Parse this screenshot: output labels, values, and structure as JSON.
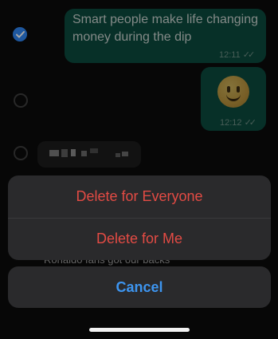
{
  "messages": [
    {
      "text": "Smart people make life changing money during the dip",
      "time": "12:11",
      "selected": true
    },
    {
      "emoji": "slightly-smiling-face-emoji",
      "time": "12:12",
      "selected": false
    },
    {
      "text": "",
      "selected": false
    }
  ],
  "preview_text": "Ronaldo fans got our backs",
  "action_sheet": {
    "delete_everyone_label": "Delete for Everyone",
    "delete_me_label": "Delete for Me",
    "cancel_label": "Cancel"
  },
  "colors": {
    "destructive": "#e34b44",
    "accent": "#3d95f0",
    "outgoing_bubble": "#0b4b3e",
    "check": "#2f86f3"
  }
}
